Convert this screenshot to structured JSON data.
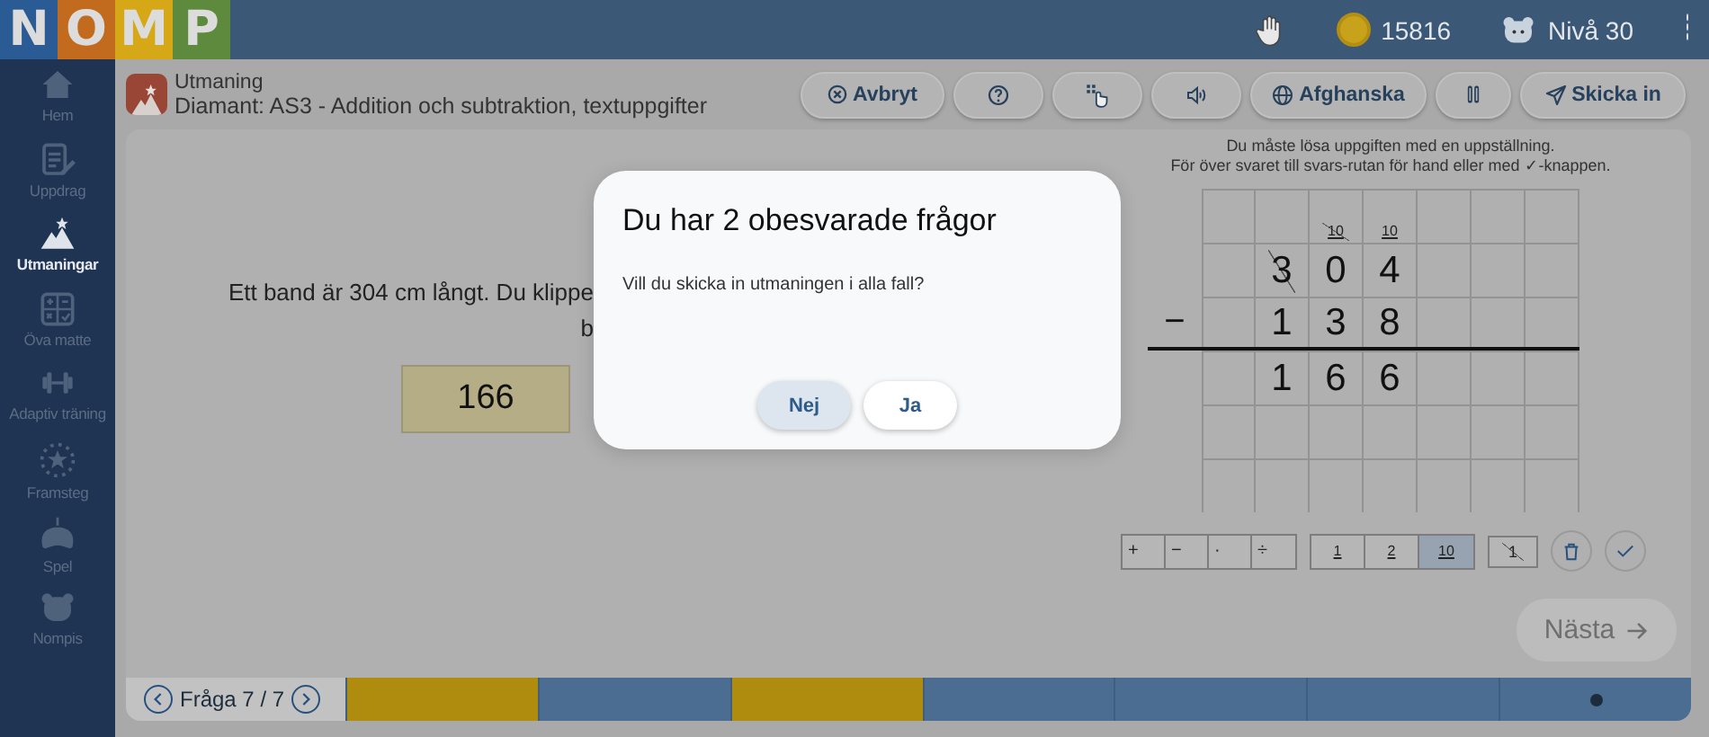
{
  "topbar": {
    "logo": [
      {
        "letter": "N",
        "color": "#2b5b94"
      },
      {
        "letter": "O",
        "color": "#c26b1e"
      },
      {
        "letter": "M",
        "color": "#d6a818"
      },
      {
        "letter": "P",
        "color": "#5d8a3c"
      }
    ],
    "coins": "15816",
    "level": "Nivå 30"
  },
  "sidebar": {
    "items": [
      {
        "label": "Hem",
        "selected": false
      },
      {
        "label": "Uppdrag",
        "selected": false
      },
      {
        "label": "Utmaningar",
        "selected": true
      },
      {
        "label": "Öva matte",
        "selected": false
      },
      {
        "label": "Adaptiv träning",
        "selected": false
      },
      {
        "label": "Framsteg",
        "selected": false
      },
      {
        "label": "Spel",
        "selected": false
      },
      {
        "label": "Nompis",
        "selected": false
      }
    ]
  },
  "header": {
    "title": "Utmaning",
    "subtitle": "Diamant: AS3 - Addition och subtraktion, textuppgifter"
  },
  "toolbar": {
    "buttons": [
      {
        "kind": "cancel",
        "label": "Avbryt"
      },
      {
        "kind": "help"
      },
      {
        "kind": "touch"
      },
      {
        "kind": "audio"
      },
      {
        "kind": "language",
        "label": "Afghanska"
      },
      {
        "kind": "pause"
      },
      {
        "kind": "submit",
        "label": "Skicka in"
      }
    ]
  },
  "question": {
    "lines": [
      "Ett band är 304 cm långt. Du klippe",
      "b"
    ],
    "answers": [
      {
        "value": "166"
      }
    ]
  },
  "instructions": [
    "Du måste lösa uppgiften med en uppställning.",
    "För över svaret till svars-rutan för hand eller med ✓-knappen."
  ],
  "grid": {
    "rows": [
      {
        "rule": false,
        "cells": [
          null,
          null,
          {
            "text": "10",
            "kind": "carry",
            "struck": true
          },
          {
            "text": "10",
            "kind": "carry",
            "struck": false
          },
          null,
          null,
          null
        ]
      },
      {
        "rule": false,
        "cells": [
          null,
          {
            "text": "3",
            "kind": "digit",
            "struck": true
          },
          {
            "text": "0",
            "kind": "digit",
            "struck": false
          },
          {
            "text": "4",
            "kind": "digit",
            "struck": false
          },
          null,
          null,
          null
        ]
      },
      {
        "sign": "−",
        "rule": true,
        "cells": [
          null,
          {
            "text": "1",
            "kind": "digit",
            "struck": false
          },
          {
            "text": "3",
            "kind": "digit",
            "struck": false
          },
          {
            "text": "8",
            "kind": "digit",
            "struck": false
          },
          null,
          null,
          null
        ]
      },
      {
        "rule": false,
        "cells": [
          null,
          {
            "text": "1",
            "kind": "digit",
            "struck": false
          },
          {
            "text": "6",
            "kind": "digit",
            "struck": false
          },
          {
            "text": "6",
            "kind": "digit",
            "struck": false
          },
          null,
          null,
          null
        ]
      },
      {
        "rule": false,
        "cells": [
          null,
          null,
          null,
          null,
          null,
          null,
          null
        ]
      },
      {
        "rule": false,
        "cells": [
          null,
          null,
          null,
          null,
          null,
          null,
          null
        ]
      }
    ]
  },
  "tools": {
    "operators": [
      {
        "label": "+"
      },
      {
        "label": "−"
      },
      {
        "label": "·"
      },
      {
        "label": "÷"
      }
    ],
    "carries": [
      {
        "label": "1",
        "selected": false
      },
      {
        "label": "2",
        "selected": false
      },
      {
        "label": "10",
        "selected": true
      }
    ],
    "strike": {
      "label": "1"
    }
  },
  "next_button": {
    "label": "Nästa",
    "disabled": true
  },
  "pager": {
    "label": "Fråga 7 / 7"
  },
  "progress": [
    {
      "color": "#b08c0e",
      "current": false
    },
    {
      "color": "#4a6d91",
      "current": false
    },
    {
      "color": "#b08c0e",
      "current": false
    },
    {
      "color": "#4a6d91",
      "current": false
    },
    {
      "color": "#4a6d91",
      "current": false
    },
    {
      "color": "#4a6d91",
      "current": false
    },
    {
      "color": "#4a6d91",
      "current": true
    }
  ],
  "dialog": {
    "title": "Du har 2 obesvarade frågor",
    "message": "Vill du skicka in utmaningen i alla fall?",
    "buttons": [
      {
        "label": "Nej",
        "focused": true
      },
      {
        "label": "Ja",
        "focused": false
      }
    ]
  }
}
